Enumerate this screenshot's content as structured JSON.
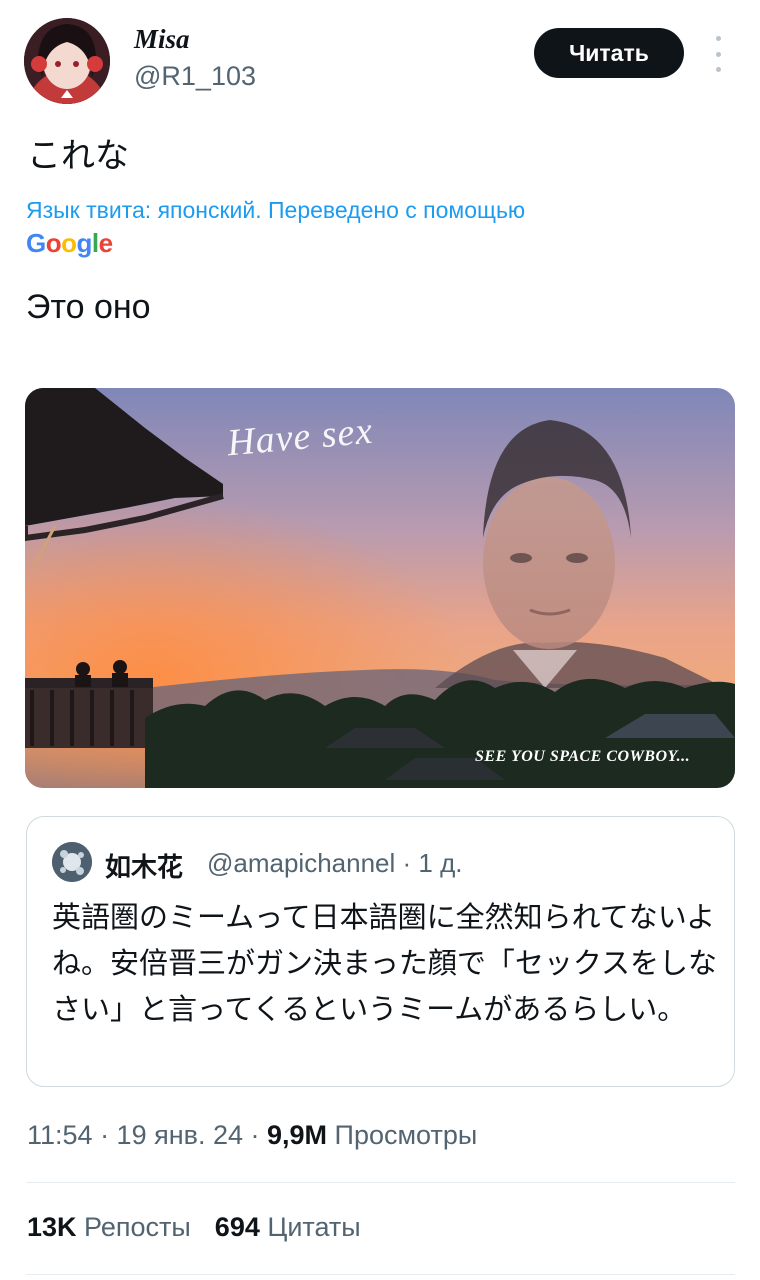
{
  "author": {
    "display_name": "Misa",
    "handle": "@R1_103",
    "follow_label": "Читать"
  },
  "tweet": {
    "text": "これな",
    "translation_note": "Язык твита: японский. Переведено с помощью",
    "translation_provider": "Google",
    "translated_text": "Это оно"
  },
  "media": {
    "caption_top": "Have sex",
    "caption_bottom": "SEE YOU SPACE COWBOY..."
  },
  "quote": {
    "name": "如木花",
    "handle_time": "@amapichannel · 1 д.",
    "body": "英語圏のミームって日本語圏に全然知られてないよね。安倍晋三がガン決まった顔で「セックスをしなさい」と言ってくるというミームがあるらしい。"
  },
  "meta": {
    "time_date": "11:54 · 19 янв. 24 · ",
    "views_count": "9,9M",
    "views_label": "Просмотры"
  },
  "stats": {
    "reposts_count": "13K",
    "reposts_label": "Репосты",
    "quotes_count": "694",
    "quotes_label": "Цитаты"
  },
  "colors": {
    "link_blue": "#1d9bf0",
    "secondary_text": "#536471",
    "button_bg": "#0f1419"
  }
}
